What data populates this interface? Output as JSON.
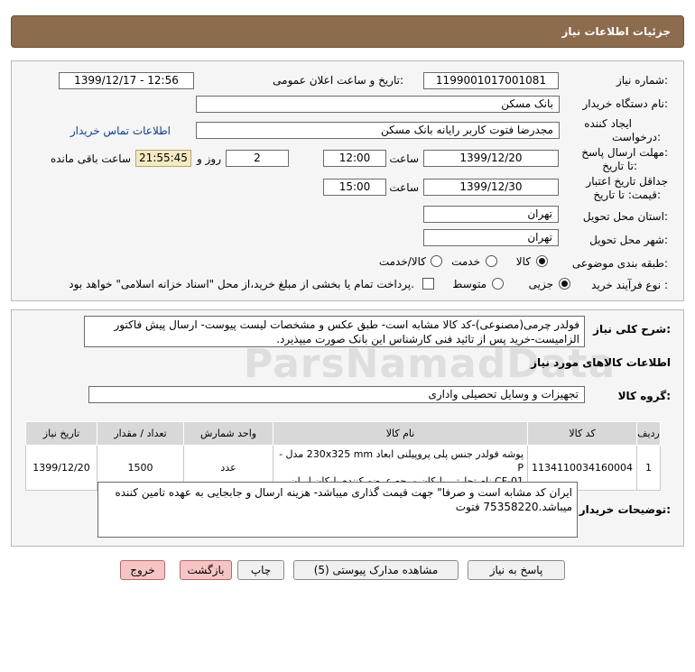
{
  "header": {
    "title": "جزئیات اطلاعات نیاز"
  },
  "need_number": {
    "label": "شماره نیاز:",
    "value": "1199001017001081"
  },
  "announce": {
    "label": "تاریخ و ساعت اعلان عمومی:",
    "value": "1399/12/17 - 12:56"
  },
  "buyer_org": {
    "label": "نام دستگاه خریدار:",
    "value": "بانک مسکن"
  },
  "requester": {
    "label_line1": "ایجاد کننده",
    "label_line2": "درخواست:",
    "value": "مجدرضا فتوت کاربر رایانه بانک مسکن",
    "contact_link": "اطلاعات تماس خریدار"
  },
  "deadline": {
    "label_line1": "مهلت ارسال پاسخ:",
    "label_line2": "تا تاریخ:",
    "date": "1399/12/20",
    "time_label": "ساعت",
    "time": "12:00",
    "days": "2",
    "days_label": "روز و",
    "remaining": "21:55:45",
    "remaining_label": "ساعت باقی مانده"
  },
  "validity": {
    "label_line1": "جداقل تاریخ اعتبار",
    "label_line2": "قیمت: تا تاریخ:",
    "date": "1399/12/30",
    "time_label": "ساعت",
    "time": "15:00"
  },
  "province": {
    "label": "استان محل تحویل:",
    "value": "تهران"
  },
  "city": {
    "label": "شهر محل تحویل:",
    "value": "تهران"
  },
  "category": {
    "label": "طبقه بندی موضوعی:",
    "options": [
      "کالا",
      "خدمت",
      "کالا/خدمت"
    ],
    "selected": "کالا"
  },
  "purchase_type": {
    "label": "نوع فرآیند خرید :",
    "options": [
      "جزیی",
      "متوسط"
    ],
    "selected": "جزیی",
    "payment_note": "پرداخت تمام یا بخشی از مبلغ خرید،از محل \"اسناد خزانه اسلامی\" خواهد بود."
  },
  "description": {
    "label": "شرح کلی نیاز:",
    "text": "فولدر چرمی(مصنوعی)-کد کالا مشابه است- طبق عکس و مشخصات لیست پیوست- ارسال پیش فاکتور الزامیست-خرید پس از تائید فنی کارشناس این بانک صورت میپذیرد."
  },
  "goods_info_title": "اطلاعات کالاهای مورد نیاز",
  "goods_group": {
    "label": "گروه کالا:",
    "value": "تجهیزات و وسایل تحصیلی واداری"
  },
  "table": {
    "headers": [
      "ردیف",
      "کد کالا",
      "نام کالا",
      "واحد شمارش",
      "تعداد / مقدار",
      "تاریخ نیاز"
    ],
    "rows": [
      {
        "row": "1",
        "code": "1134110034160004",
        "name_line1": "پوشه فولدر جنس پلی پروپیلنی ابعاد 230x325 mm مدل -P",
        "name_line2": "CF-01 نام تجارتی پلیکان مرجع عرضه کننده پلیکان ایران",
        "unit": "عدد",
        "qty": "1500",
        "date": "1399/12/20"
      }
    ]
  },
  "buyer_notes": {
    "label": "توضیحات خریدار:",
    "text": "ایران کد مشابه است و صرفا\" جهت قیمت گذاری میباشد- هزینه ارسال و جابجایی به عهده تامین کننده میباشد.75358220 فتوت"
  },
  "buttons": {
    "reply": "پاسخ به نیاز",
    "attachments": "مشاهده مدارک پیوستی (5)",
    "print": "چاپ",
    "back": "بازگشت",
    "exit": "خروج"
  },
  "watermark": {
    "brand": "ParsNamadData"
  }
}
